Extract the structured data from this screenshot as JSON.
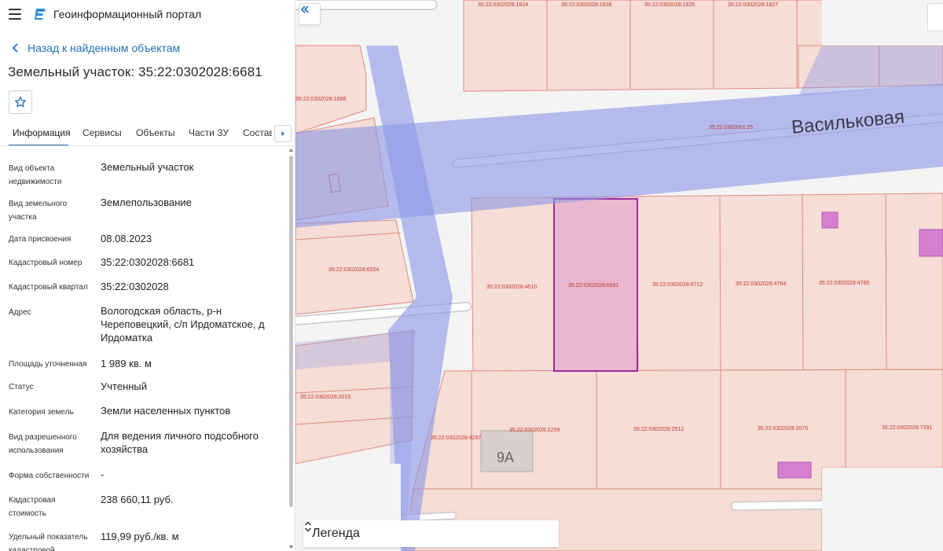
{
  "app": {
    "title": "Геоинформационный портал"
  },
  "panel": {
    "back_label": "Назад к найденным объектам",
    "title": "Земельный участок: 35:22:0302028:6681",
    "tabs": [
      {
        "label": "Информация",
        "active": true
      },
      {
        "label": "Сервисы"
      },
      {
        "label": "Объекты"
      },
      {
        "label": "Части ЗУ"
      },
      {
        "label": "Состав"
      }
    ],
    "properties": [
      {
        "label": "Вид объекта недвижимости",
        "value": "Земельный участок"
      },
      {
        "label": "Вид земельного участка",
        "value": "Землепользование"
      },
      {
        "label": "Дата присвоения",
        "value": "08.08.2023"
      },
      {
        "label": "Кадастровый номер",
        "value": "35:22:0302028:6681"
      },
      {
        "label": "Кадастровый квартал",
        "value": "35:22:0302028"
      },
      {
        "label": "Адрес",
        "value": "Вологодская область, р-н Череповецкий, с/п Ирдоматское, д Ирдоматка"
      },
      {
        "label": "Площадь уточненная",
        "value": "1 989 кв. м"
      },
      {
        "label": "Статус",
        "value": "Учтенный"
      },
      {
        "label": "Категория земель",
        "value": "Земли населенных пунктов"
      },
      {
        "label": "Вид разрешенного использования",
        "value": "Для ведения личного подсобного хозяйства"
      },
      {
        "label": "Форма собственности",
        "value": "-"
      },
      {
        "label": "Кадастровая стоимость",
        "value": "238 660,11 руб."
      },
      {
        "label": "Удельный показатель кадастровой",
        "value": "119,99 руб./кв. м"
      }
    ]
  },
  "map": {
    "street_label": "Васильковая",
    "house_label": "9А",
    "parcel_labels": [
      "35:22:0302028:1824",
      "35:22:0302028:1828",
      "35:22:0302028:1825",
      "35:22:0302028:1827",
      "35:22:0302028:1888",
      "35:22:0302001:25",
      "35:22:0302028:6554",
      "35:22:0302028:4510",
      "35:22:0302028:6681",
      "35:22:0302028:6712",
      "35:22:0302028:4764",
      "35:22:0302028:4765",
      "35:22:0302028:2015",
      "35:22:0302028:4297",
      "35:22:0302028:2209",
      "35:22:0302028:2512",
      "35:22:0302028:2075",
      "35:22:0302028:7391"
    ],
    "legend_label": "Легенда"
  },
  "colors": {
    "accent": "#1f6fb8",
    "parcel_fill": "#f6ddd6",
    "parcel_stroke": "#e08a7e",
    "selected_fill": "#e9b7cf",
    "selected_stroke": "#9c2a9c",
    "band_fill": "#8c98e6",
    "building_fill": "#d67fd0"
  },
  "icons": [
    "menu-icon",
    "portal-logo-icon",
    "chevron-left-icon",
    "star-icon",
    "chevron-right-icon",
    "double-chevron-left-icon",
    "chevron-up-down-icon"
  ]
}
